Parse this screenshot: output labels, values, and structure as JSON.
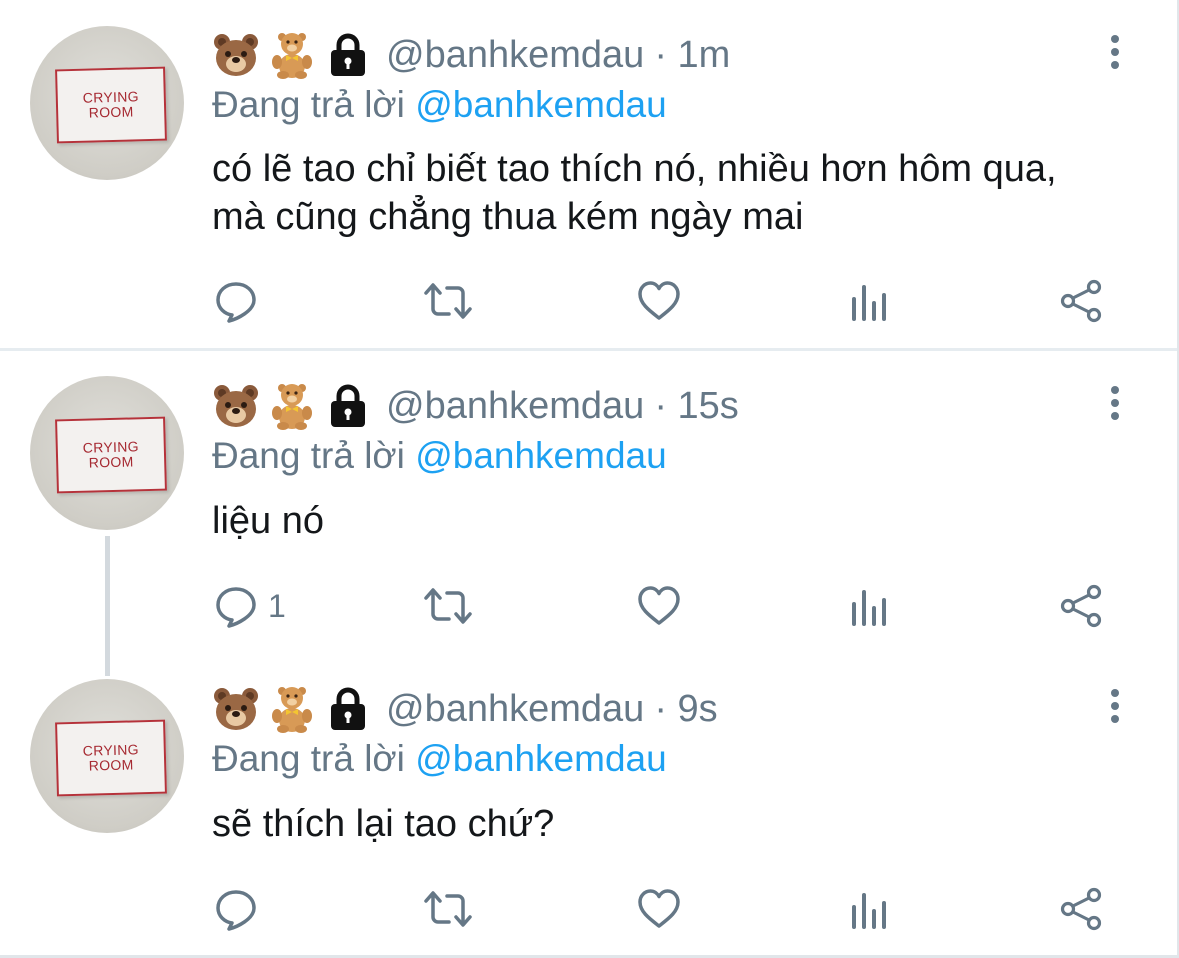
{
  "colors": {
    "text": "#14171a",
    "muted": "#657786",
    "link": "#1da1f2",
    "divider": "#e6ecf0"
  },
  "avatar_sign": {
    "line1": "CRYING",
    "line2": "ROOM"
  },
  "header_icons": [
    "bear-face-icon",
    "teddy-bear-icon",
    "lock-icon"
  ],
  "tweets": [
    {
      "handle": "@banhkemdau",
      "time": "· 1m",
      "reply_prefix": "Đang trả lời",
      "reply_to": "@banhkemdau",
      "text_lines": [
        "có lẽ tao chỉ biết tao thích nó, nhiều hơn hôm qua,",
        "mà cũng chẳng thua kém ngày mai"
      ],
      "reply_count": ""
    },
    {
      "handle": "@banhkemdau",
      "time": "· 15s",
      "reply_prefix": "Đang trả lời",
      "reply_to": "@banhkemdau",
      "text_lines": [
        "liệu nó"
      ],
      "reply_count": "1"
    },
    {
      "handle": "@banhkemdau",
      "time": "· 9s",
      "reply_prefix": "Đang trả lời",
      "reply_to": "@banhkemdau",
      "text_lines": [
        "sẽ thích lại tao chứ?"
      ],
      "reply_count": ""
    }
  ]
}
